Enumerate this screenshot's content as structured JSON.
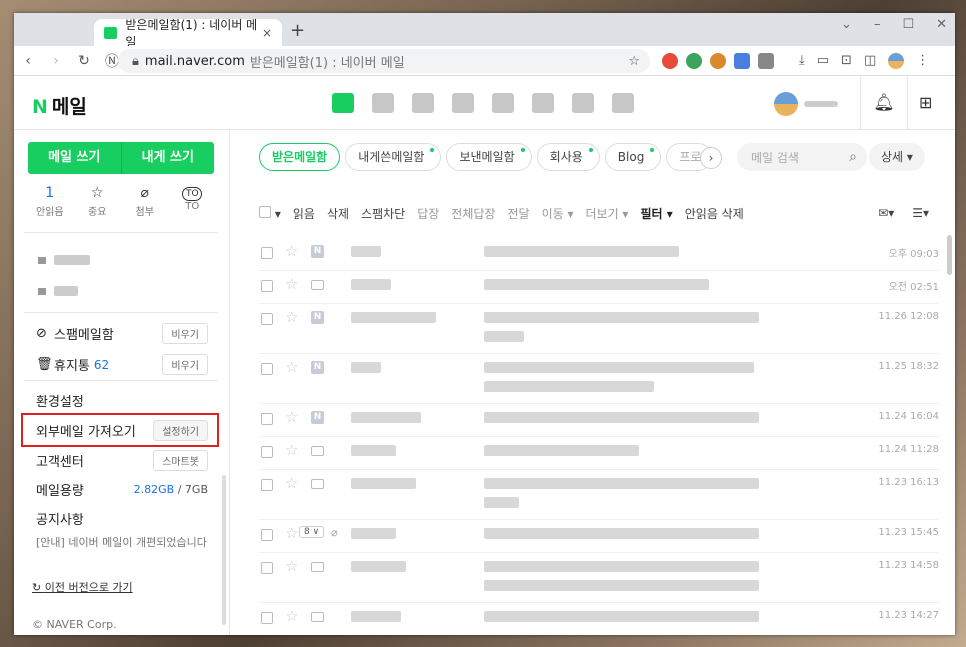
{
  "browser": {
    "tab_title": "받은메일함(1) : 네이버 메일",
    "tab_close": "×",
    "new_tab": "+",
    "url_host": "mail.naver.com",
    "url_title": "받은메일함(1) : 네이버 메일"
  },
  "app": {
    "logo_n": "N",
    "logo_text": "메일",
    "user_name": ""
  },
  "sidebar": {
    "write_mail": "메일 쓰기",
    "write_self": "내게 쓰기",
    "quick": [
      {
        "top": "1",
        "label": "안읽음"
      },
      {
        "top": "☆",
        "label": "중요"
      },
      {
        "top": "⌀",
        "label": "첨부"
      },
      {
        "top": "TO",
        "label": "TO"
      }
    ],
    "spam_label": "스팸메일함",
    "spam_button": "비우기",
    "trash_label": "휴지통",
    "trash_count": "62",
    "trash_button": "비우기",
    "settings": "환경설정",
    "external_mail": "외부메일 가져오기",
    "external_button": "설정하기",
    "support": "고객센터",
    "support_button": "스마트봇",
    "quota_label": "메일용량",
    "quota_used": "2.82GB",
    "quota_total": "/ 7GB",
    "notice_label": "공지사항",
    "notice_text": "[안내] 네이버 메일이 개편되었습니다",
    "old_version": "이전 버전으로 가기",
    "copyright": "© NAVER Corp."
  },
  "main": {
    "folder_tabs": [
      {
        "label": "받은메일함",
        "active": true
      },
      {
        "label": "내게쓴메일함",
        "dot": true
      },
      {
        "label": "보낸메일함",
        "dot": true
      },
      {
        "label": "회사용",
        "dot": true
      },
      {
        "label": "Blog",
        "dot": true
      },
      {
        "label": "프로"
      }
    ],
    "search_placeholder": "메일 검색",
    "detail_button": "상세 ▾",
    "toolbar": {
      "read": "읽음",
      "delete": "삭제",
      "spam": "스팸차단",
      "reply": "답장",
      "reply_all": "전체답장",
      "forward": "전달",
      "move": "이동 ▾",
      "more": "더보기 ▾",
      "filter": "필터 ▾",
      "delete_unread": "안읽음 삭제"
    },
    "emails": [
      {
        "date": "오후 09:03",
        "type": "N"
      },
      {
        "date": "오전 02:51",
        "type": "env"
      },
      {
        "date": "11.26 12:08",
        "type": "N"
      },
      {
        "date": "11.25 18:32",
        "type": "N"
      },
      {
        "date": "11.24 16:04",
        "type": "N"
      },
      {
        "date": "11.24 11:28",
        "type": "env"
      },
      {
        "date": "11.23 16:13",
        "type": "env"
      },
      {
        "date": "11.23 15:45",
        "type": "badge",
        "badge": "8 ∨"
      },
      {
        "date": "11.23 14:58",
        "type": "env"
      },
      {
        "date": "11.23 14:27",
        "type": "env"
      }
    ]
  }
}
